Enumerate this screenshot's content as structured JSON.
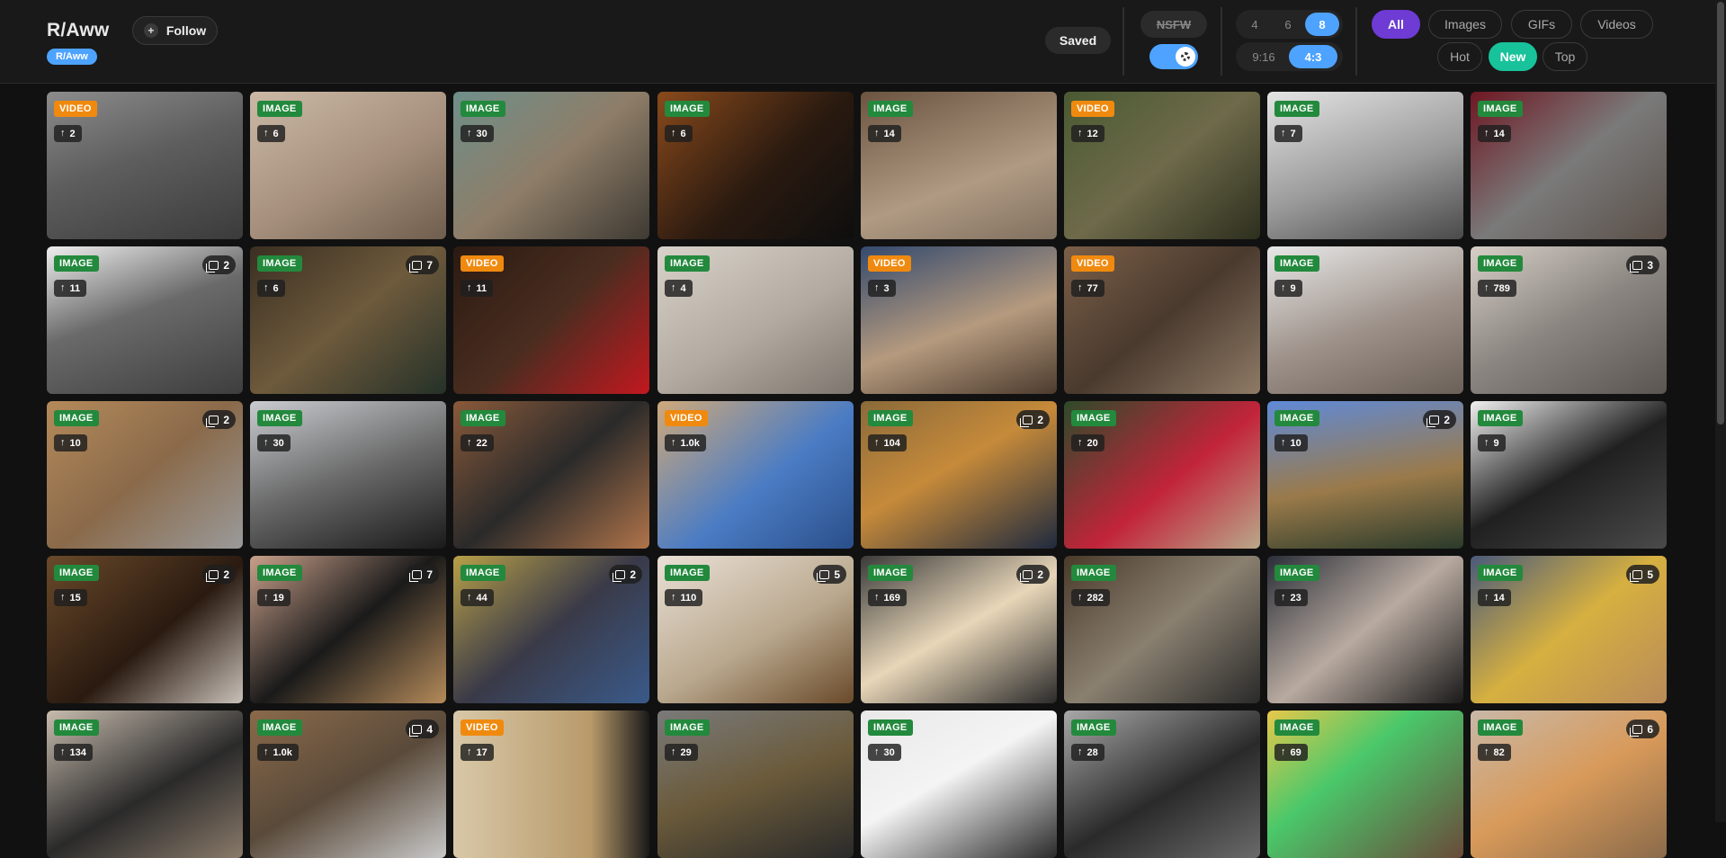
{
  "header": {
    "subreddit_title": "R/Aww",
    "subreddit_tag": "R/Aww",
    "follow_label": "Follow",
    "follow_icon": "plus-icon",
    "saved_label": "Saved",
    "nsfw_label": "NSFW",
    "nsfw_toggle_on": true,
    "columns": {
      "options": [
        "4",
        "6",
        "8"
      ],
      "selected": "8"
    },
    "aspect": {
      "options": [
        "9:16",
        "4:3"
      ],
      "selected": "4:3"
    },
    "media_tabs": {
      "options": [
        "All",
        "Images",
        "GIFs",
        "Videos"
      ],
      "selected": "All"
    },
    "sort_tabs": {
      "options": [
        "Hot",
        "New",
        "Top"
      ],
      "selected": "New"
    }
  },
  "colors": {
    "accent_blue": "#4da3ff",
    "accent_purple": "#6e3bd4",
    "accent_green": "#18c29a",
    "badge_image": "#23893d",
    "badge_video": "#f08a0f"
  },
  "posts": [
    {
      "type": "VIDEO",
      "score": "2"
    },
    {
      "type": "IMAGE",
      "score": "6"
    },
    {
      "type": "IMAGE",
      "score": "30"
    },
    {
      "type": "IMAGE",
      "score": "6"
    },
    {
      "type": "IMAGE",
      "score": "14"
    },
    {
      "type": "VIDEO",
      "score": "12"
    },
    {
      "type": "IMAGE",
      "score": "7"
    },
    {
      "type": "IMAGE",
      "score": "14"
    },
    {
      "type": "IMAGE",
      "score": "11",
      "gallery": "2"
    },
    {
      "type": "IMAGE",
      "score": "6",
      "gallery": "7"
    },
    {
      "type": "VIDEO",
      "score": "11"
    },
    {
      "type": "IMAGE",
      "score": "4"
    },
    {
      "type": "VIDEO",
      "score": "3"
    },
    {
      "type": "VIDEO",
      "score": "77"
    },
    {
      "type": "IMAGE",
      "score": "9"
    },
    {
      "type": "IMAGE",
      "score": "789",
      "gallery": "3"
    },
    {
      "type": "IMAGE",
      "score": "10",
      "gallery": "2"
    },
    {
      "type": "IMAGE",
      "score": "30"
    },
    {
      "type": "IMAGE",
      "score": "22"
    },
    {
      "type": "VIDEO",
      "score": "1.0k"
    },
    {
      "type": "IMAGE",
      "score": "104",
      "gallery": "2"
    },
    {
      "type": "IMAGE",
      "score": "20"
    },
    {
      "type": "IMAGE",
      "score": "10",
      "gallery": "2"
    },
    {
      "type": "IMAGE",
      "score": "9"
    },
    {
      "type": "IMAGE",
      "score": "15",
      "gallery": "2"
    },
    {
      "type": "IMAGE",
      "score": "19",
      "gallery": "7"
    },
    {
      "type": "IMAGE",
      "score": "44",
      "gallery": "2"
    },
    {
      "type": "IMAGE",
      "score": "110",
      "gallery": "5"
    },
    {
      "type": "IMAGE",
      "score": "169",
      "gallery": "2"
    },
    {
      "type": "IMAGE",
      "score": "282"
    },
    {
      "type": "IMAGE",
      "score": "23"
    },
    {
      "type": "IMAGE",
      "score": "14",
      "gallery": "5"
    },
    {
      "type": "IMAGE",
      "score": "134"
    },
    {
      "type": "IMAGE",
      "score": "1.0k",
      "gallery": "4"
    },
    {
      "type": "VIDEO",
      "score": "17"
    },
    {
      "type": "IMAGE",
      "score": "29"
    },
    {
      "type": "IMAGE",
      "score": "30"
    },
    {
      "type": "IMAGE",
      "score": "28"
    },
    {
      "type": "IMAGE",
      "score": "69"
    },
    {
      "type": "IMAGE",
      "score": "82",
      "gallery": "6"
    }
  ]
}
